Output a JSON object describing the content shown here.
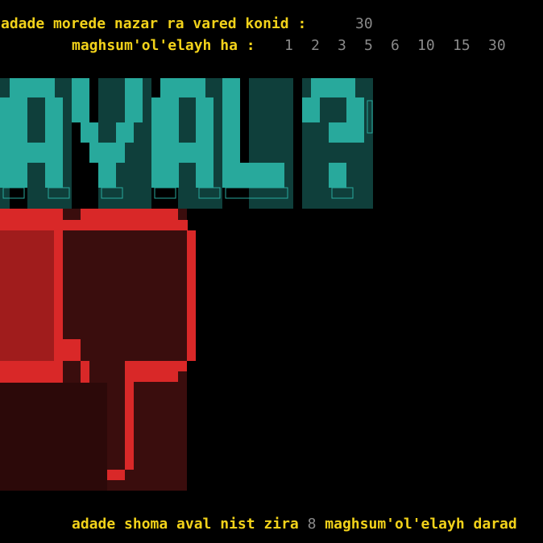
{
  "prompt_input": {
    "label": "adade morede nazar ra vared konid :",
    "value": "30"
  },
  "divisors_line": {
    "label": "maghsum'ol'elayh ha :",
    "values": [
      "1",
      "2",
      "3",
      "5",
      "6",
      "10",
      "15",
      "30"
    ]
  },
  "banner": {
    "text": "AVAL?",
    "colors": {
      "teal": "#28a99c",
      "teal_dark": "#0f3f3b",
      "red": "#d92828",
      "red_dark": "#3a0d0d"
    }
  },
  "thumbs_down_icon": "thumbs-down-icon",
  "result": {
    "prefix": "adade shoma aval nist zira",
    "count": "8",
    "suffix": "maghsum'ol'elayh darad"
  },
  "colors": {
    "text": "#f2d21a",
    "muted": "#8a8a8a",
    "background": "#000000"
  }
}
